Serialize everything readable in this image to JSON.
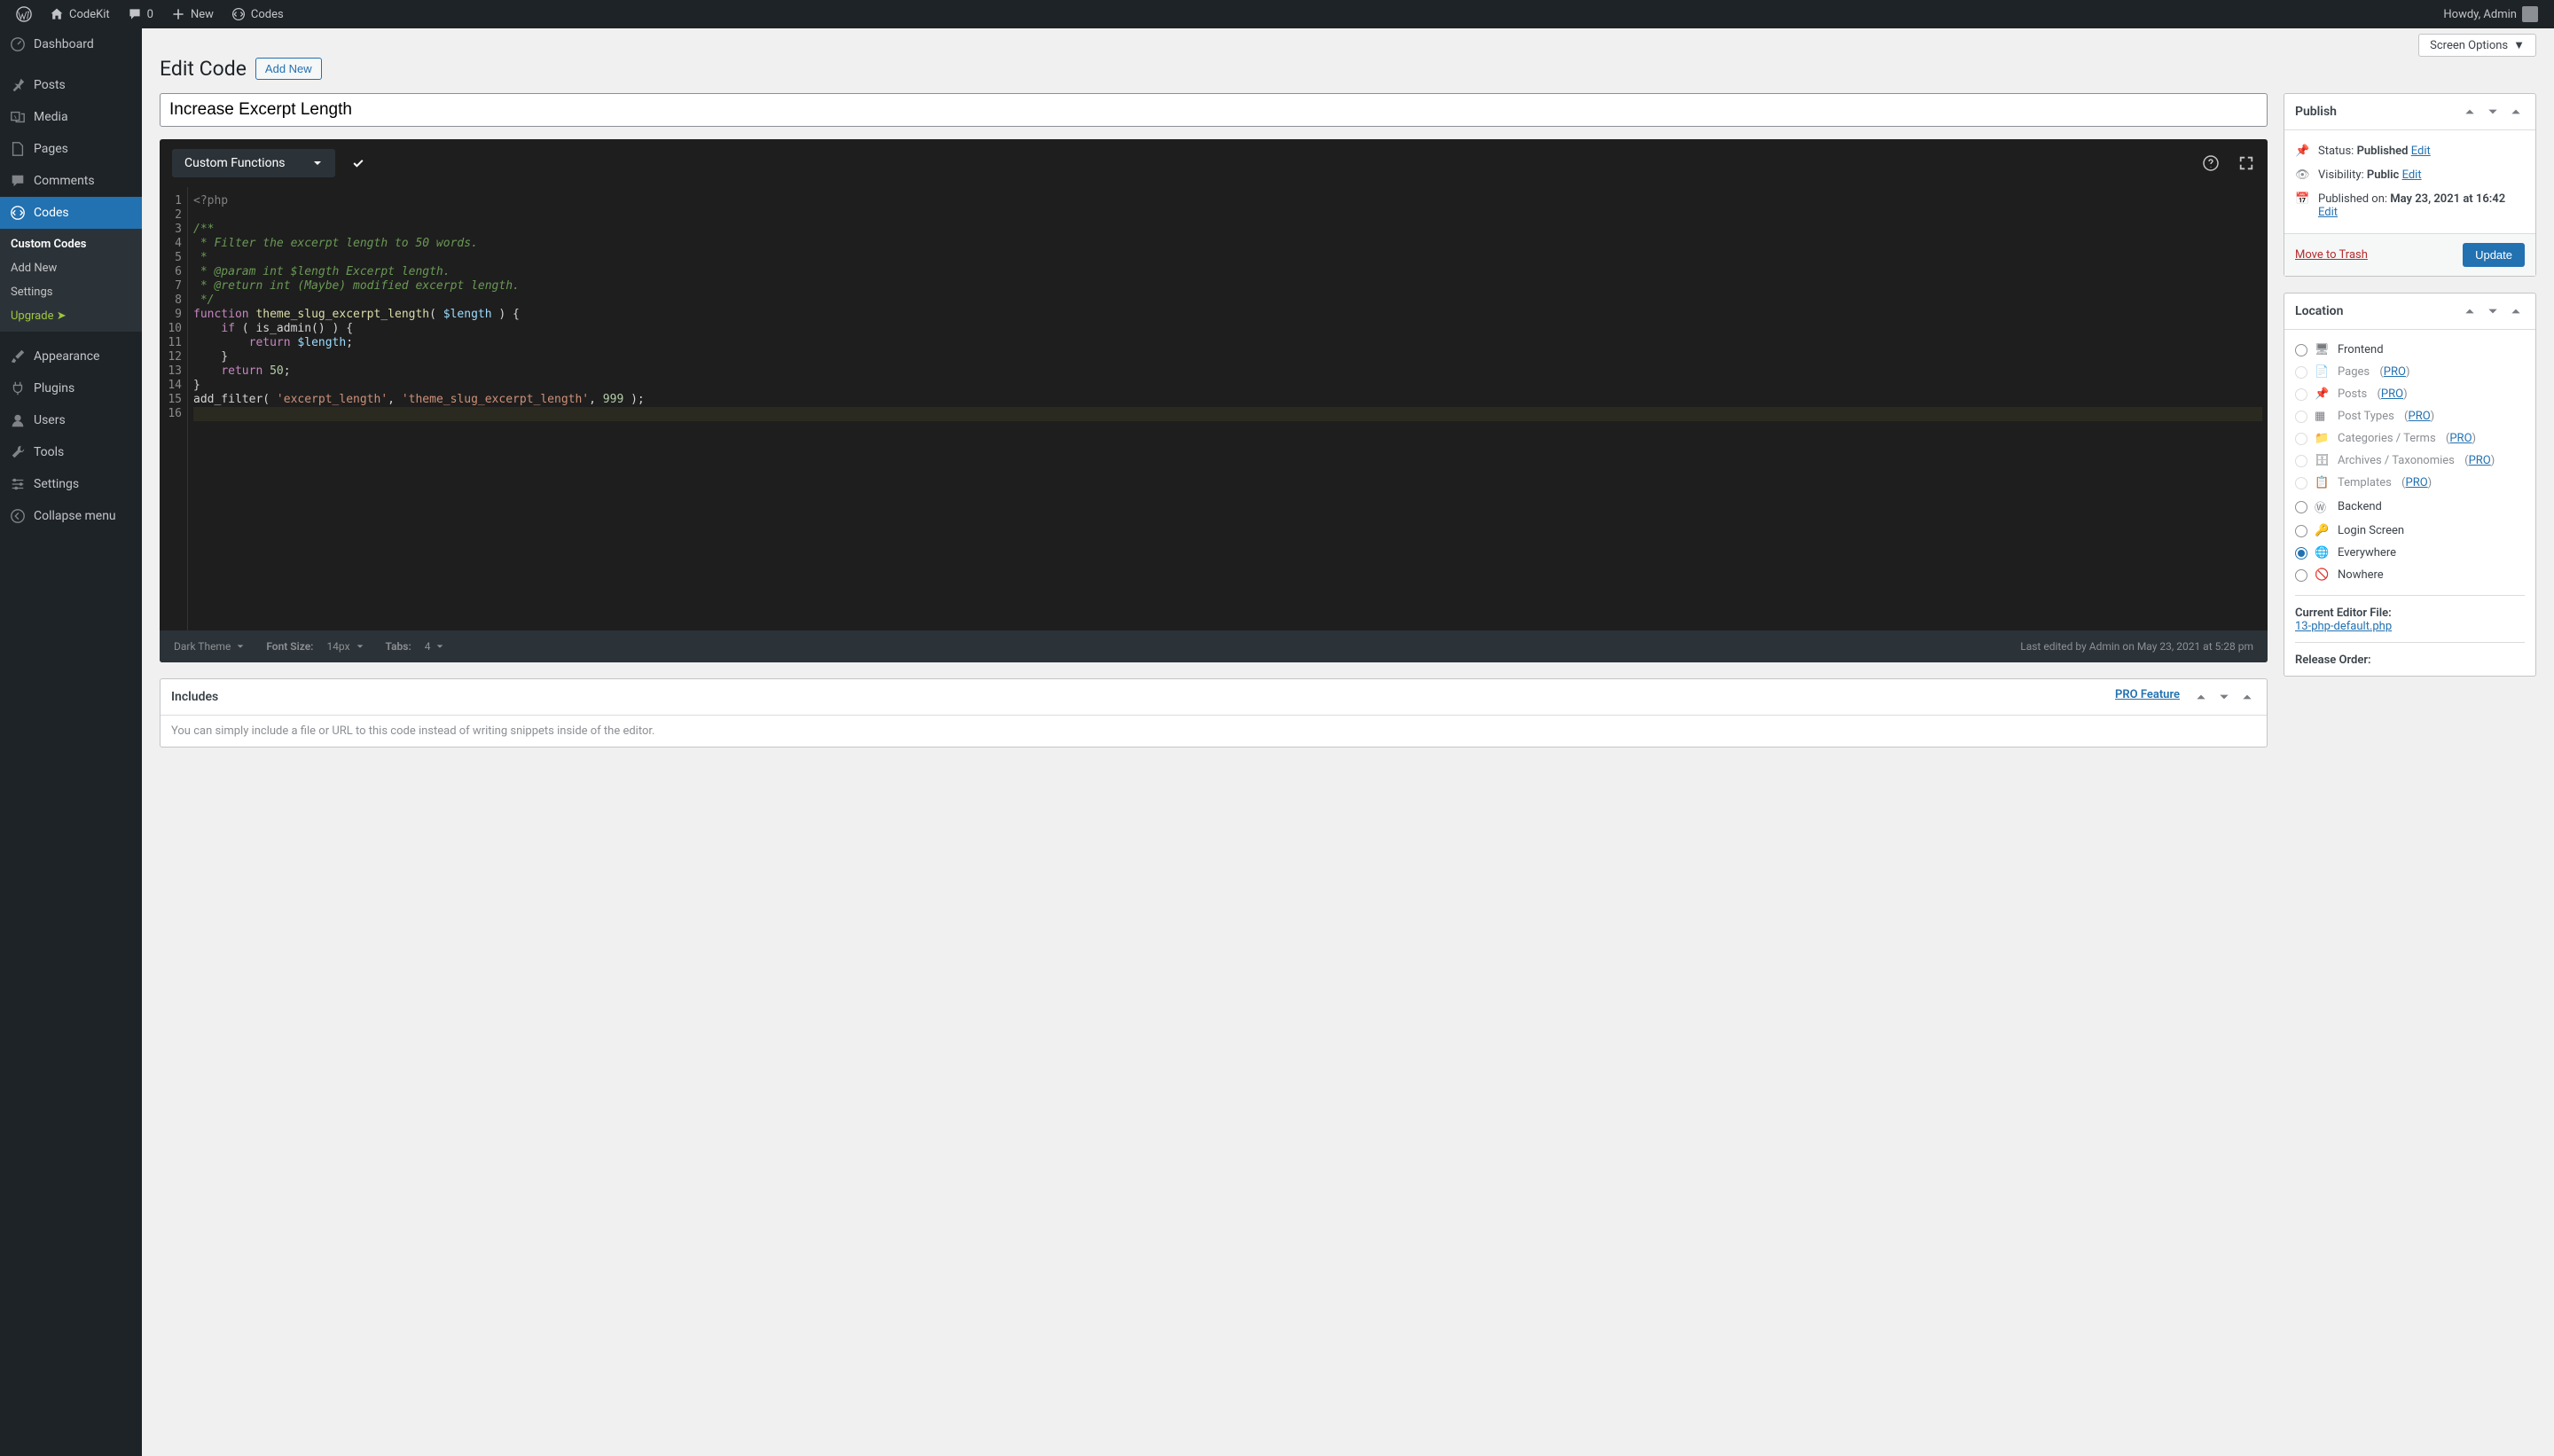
{
  "topbar": {
    "site_name": "CodeKit",
    "comments_count": "0",
    "new_label": "New",
    "codes_label": "Codes",
    "howdy": "Howdy, Admin"
  },
  "sidebar": {
    "items": [
      {
        "name": "dashboard",
        "label": "Dashboard",
        "icon": "dashboard"
      },
      {
        "name": "posts",
        "label": "Posts",
        "icon": "pin"
      },
      {
        "name": "media",
        "label": "Media",
        "icon": "media"
      },
      {
        "name": "pages",
        "label": "Pages",
        "icon": "page"
      },
      {
        "name": "comments",
        "label": "Comments",
        "icon": "comment"
      },
      {
        "name": "codes",
        "label": "Codes",
        "icon": "code",
        "current": true
      },
      {
        "name": "appearance",
        "label": "Appearance",
        "icon": "brush"
      },
      {
        "name": "plugins",
        "label": "Plugins",
        "icon": "plug"
      },
      {
        "name": "users",
        "label": "Users",
        "icon": "user"
      },
      {
        "name": "tools",
        "label": "Tools",
        "icon": "wrench"
      },
      {
        "name": "settings",
        "label": "Settings",
        "icon": "sliders"
      },
      {
        "name": "collapse",
        "label": "Collapse menu",
        "icon": "collapse"
      }
    ],
    "codes_submenu": [
      {
        "label": "Custom Codes",
        "current": true
      },
      {
        "label": "Add New"
      },
      {
        "label": "Settings"
      },
      {
        "label": "Upgrade  ➤",
        "upgrade": true
      }
    ]
  },
  "screen_options": "Screen Options",
  "page_heading": "Edit Code",
  "add_new": "Add New",
  "title_value": "Increase Excerpt Length",
  "editor": {
    "language_dropdown": "Custom Functions",
    "lines": 16,
    "theme_label": "Dark Theme",
    "font_size_label": "Font Size:",
    "font_size_value": "14px",
    "tabs_label": "Tabs:",
    "tabs_value": "4",
    "last_edited": "Last edited by Admin on May 23, 2021 at 5:28 pm",
    "code": [
      {
        "t": "<?php",
        "c": "tag"
      },
      {
        "t": ""
      },
      {
        "t": "/**",
        "c": "com"
      },
      {
        "t": " * Filter the excerpt length to 50 words.",
        "c": "com"
      },
      {
        "t": " *",
        "c": "com"
      },
      {
        "t": " * @param int $length Excerpt length.",
        "c": "com"
      },
      {
        "t": " * @return int (Maybe) modified excerpt length.",
        "c": "com"
      },
      {
        "t": " */",
        "c": "com"
      },
      {
        "raw": "<span class='c-kw'>function</span> <span class='c-fn'>theme_slug_excerpt_length</span>( <span class='c-var'>$length</span> ) {"
      },
      {
        "raw": "    <span class='c-kw'>if</span> ( is_admin() ) {"
      },
      {
        "raw": "        <span class='c-kw'>return</span> <span class='c-var'>$length</span>;"
      },
      {
        "raw": "    }"
      },
      {
        "raw": "    <span class='c-kw'>return</span> <span class='c-num'>50</span>;"
      },
      {
        "raw": "}"
      },
      {
        "raw": "add_filter( <span class='c-str'>'excerpt_length'</span>, <span class='c-str'>'theme_slug_excerpt_length'</span>, <span class='c-num'>999</span> );"
      },
      {
        "t": "",
        "hl": true
      }
    ]
  },
  "publish_box": {
    "title": "Publish",
    "status_label": "Status:",
    "status_value": "Published",
    "edit": "Edit",
    "visibility_label": "Visibility:",
    "visibility_value": "Public",
    "published_label": "Published on:",
    "published_value": "May 23, 2021 at 16:42",
    "trash": "Move to Trash",
    "update": "Update"
  },
  "location_box": {
    "title": "Location",
    "items": [
      {
        "label": "Frontend",
        "icon": "monitor",
        "enabled": true,
        "checked": false
      },
      {
        "label": "Pages",
        "icon": "page",
        "enabled": false,
        "pro": true
      },
      {
        "label": "Posts",
        "icon": "pin",
        "enabled": false,
        "pro": true
      },
      {
        "label": "Post Types",
        "icon": "grid",
        "enabled": false,
        "pro": true
      },
      {
        "label": "Categories / Terms",
        "icon": "folder",
        "enabled": false,
        "pro": true
      },
      {
        "label": "Archives / Taxonomies",
        "icon": "archive",
        "enabled": false,
        "pro": true
      },
      {
        "label": "Templates",
        "icon": "template",
        "enabled": false,
        "pro": true
      },
      {
        "label": "Backend",
        "icon": "wp",
        "enabled": true,
        "checked": false
      },
      {
        "label": "Login Screen",
        "icon": "key",
        "enabled": true,
        "checked": false
      },
      {
        "label": "Everywhere",
        "icon": "globe",
        "enabled": true,
        "checked": true
      },
      {
        "label": "Nowhere",
        "icon": "hidden",
        "enabled": true,
        "checked": false
      }
    ],
    "pro_text": "PRO",
    "current_file_label": "Current Editor File:",
    "current_file": "13-php-default.php",
    "release_label": "Release Order:"
  },
  "includes_box": {
    "title": "Includes",
    "pro": "PRO Feature",
    "desc": "You can simply include a file or URL to this code instead of writing snippets inside of the editor."
  }
}
